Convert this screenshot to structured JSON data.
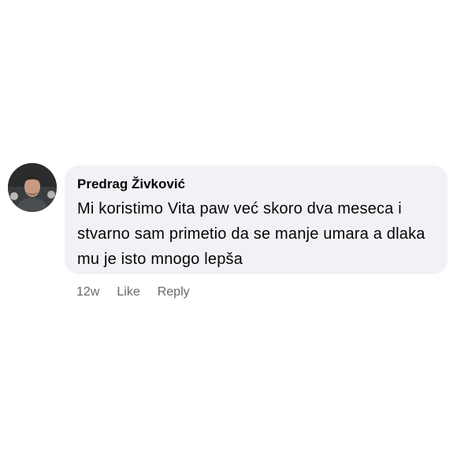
{
  "comment": {
    "author": "Predrag Živković",
    "text": "Mi koristimo Vita paw već skoro dva meseca i stvarno sam primetio da se manje umara a dlaka mu je isto mnogo lepša",
    "avatar_icon": "profile-photo",
    "timestamp": "12w",
    "like_label": "Like",
    "reply_label": "Reply",
    "bubble_color": "#f0f2f5",
    "meta_color": "#65676b"
  }
}
